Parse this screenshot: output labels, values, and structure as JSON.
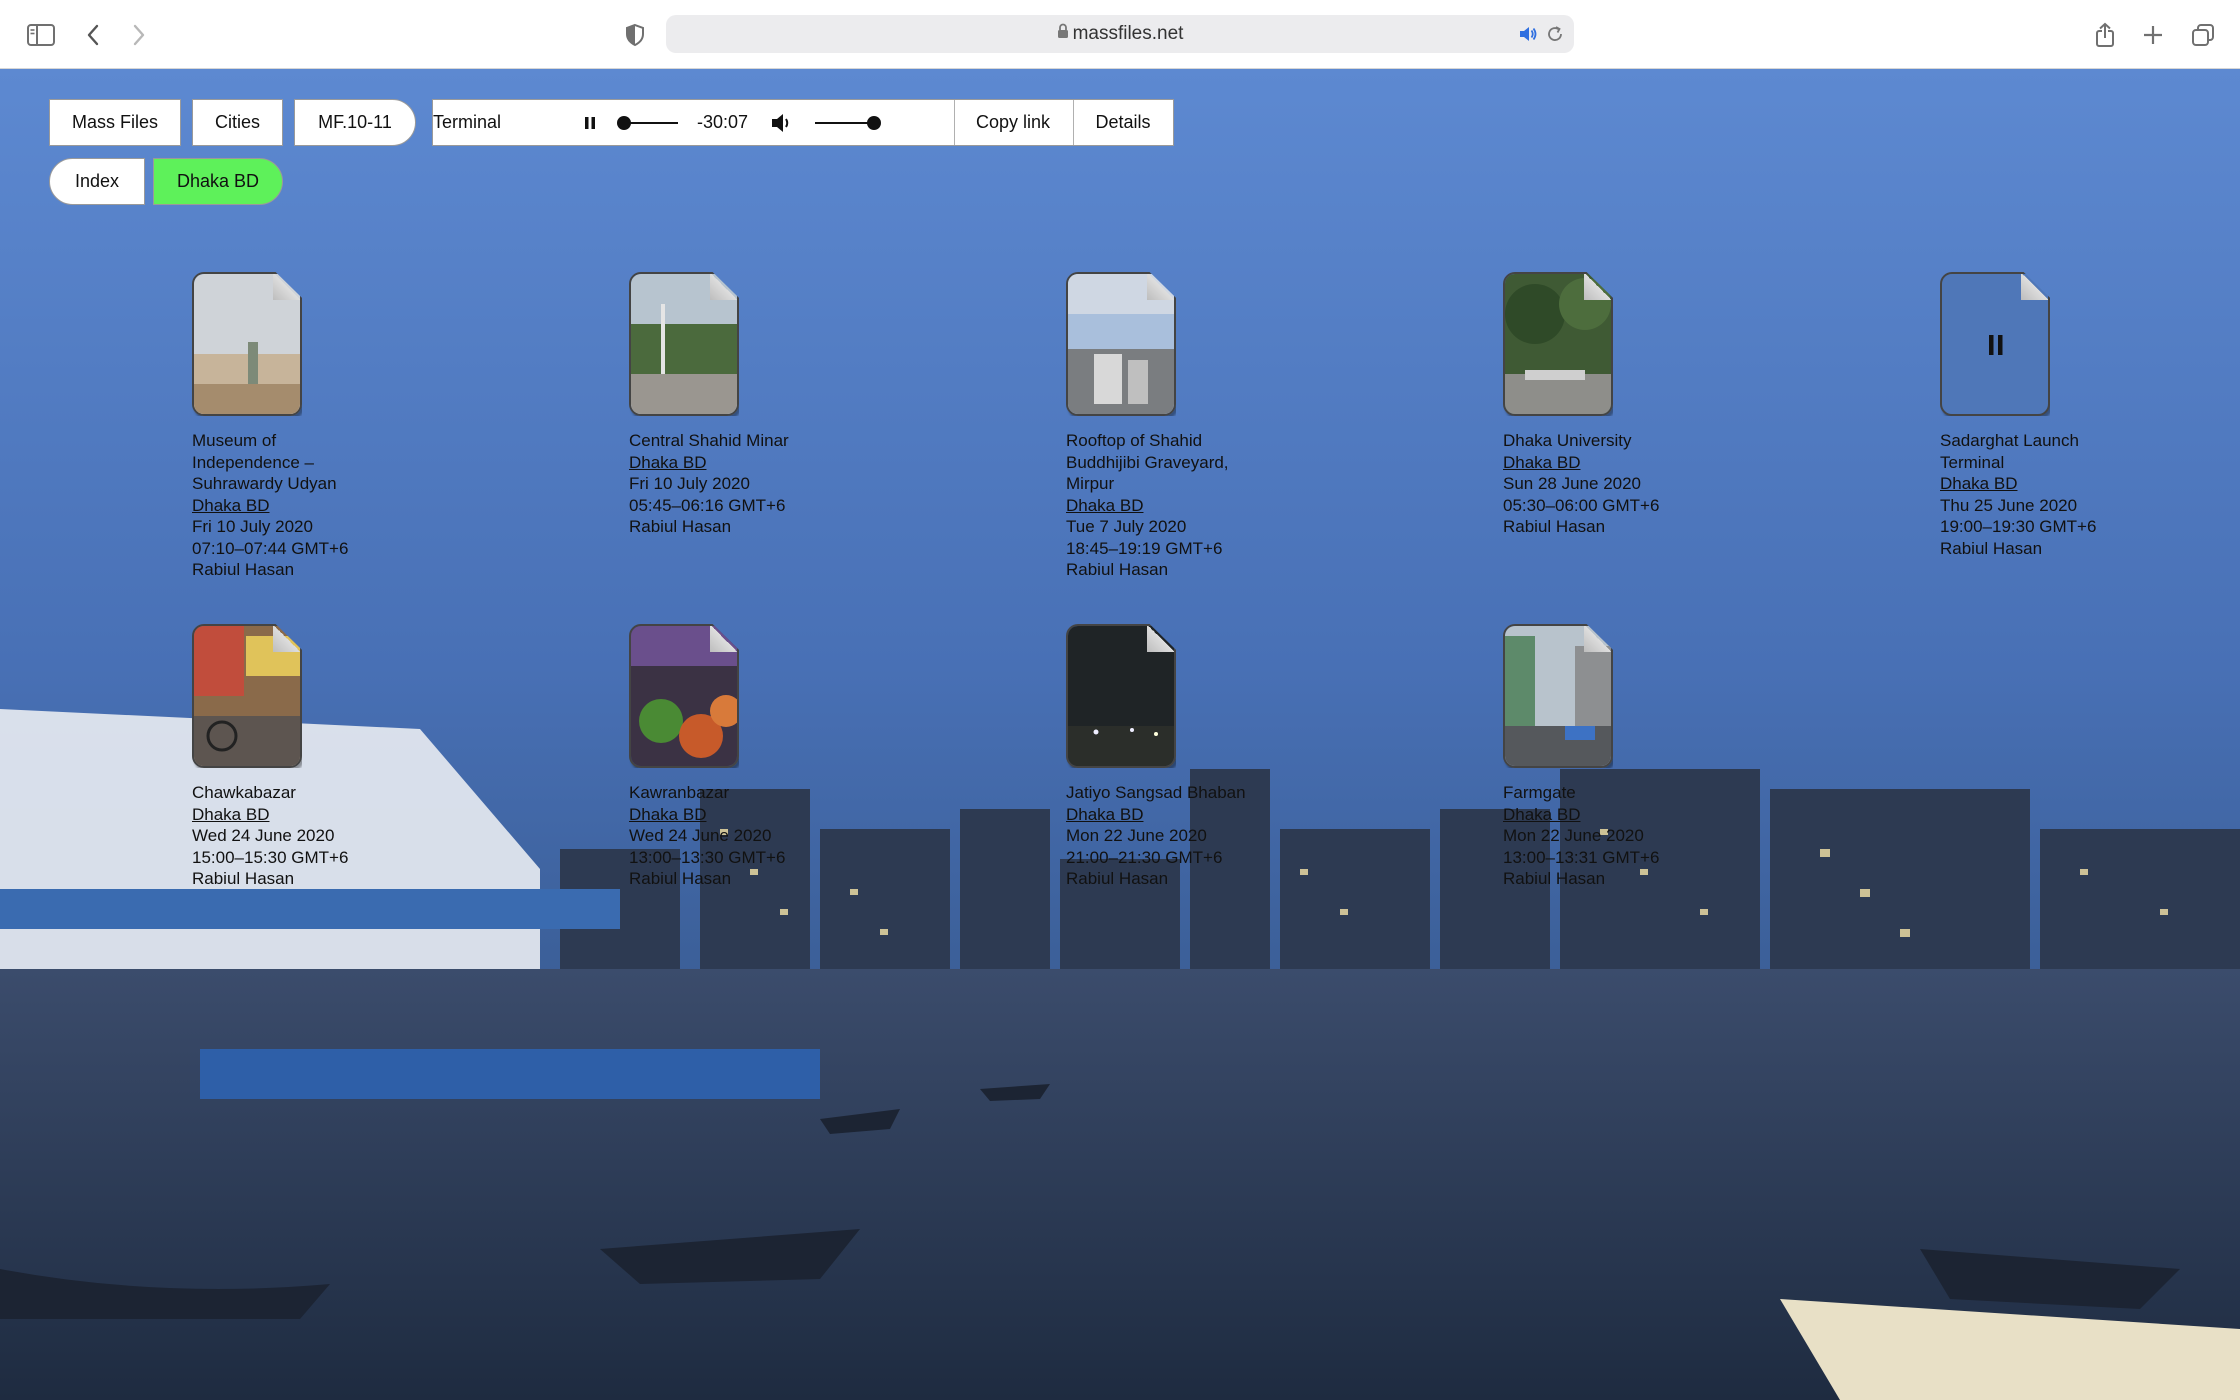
{
  "browser": {
    "url": "massfiles.net"
  },
  "nav": {
    "mass_files": "Mass Files",
    "cities": "Cities",
    "series": "MF.10-11",
    "index": "Index",
    "current_city": "Dhaka BD"
  },
  "player": {
    "track": "Terminal",
    "time": "-30:07",
    "progress_fraction": 0.02,
    "volume_fraction": 0.93,
    "copy_link": "Copy link",
    "details": "Details"
  },
  "files": [
    {
      "title": "Museum of\nIndependence –\nSuhrawardy Udyan",
      "city": "Dhaka BD",
      "date": "Fri 10 July 2020",
      "time": "07:10–07:44 GMT+6",
      "author": "Rabiul Hasan"
    },
    {
      "title": "Central Shahid Minar",
      "city": "Dhaka BD",
      "date": "Fri 10 July 2020",
      "time": "05:45–06:16 GMT+6",
      "author": "Rabiul Hasan"
    },
    {
      "title": "Rooftop of Shahid\nBuddhijibi Graveyard,\nMirpur",
      "city": "Dhaka BD",
      "date": "Tue 7 July 2020",
      "time": "18:45–19:19 GMT+6",
      "author": "Rabiul Hasan"
    },
    {
      "title": "Dhaka University",
      "city": "Dhaka BD",
      "date": "Sun 28 June 2020",
      "time": "05:30–06:00 GMT+6",
      "author": "Rabiul Hasan"
    },
    {
      "title": "Sadarghat Launch\nTerminal",
      "city": "Dhaka BD",
      "date": "Thu 25 June 2020",
      "time": "19:00–19:30 GMT+6",
      "author": "Rabiul Hasan",
      "playing_icon": "pause-icon"
    },
    {
      "title": "Chawkabazar",
      "city": "Dhaka BD",
      "date": "Wed 24 June 2020",
      "time": "15:00–15:30 GMT+6",
      "author": "Rabiul Hasan"
    },
    {
      "title": "Kawranbazar",
      "city": "Dhaka BD",
      "date": "Wed 24 June 2020",
      "time": "13:00–13:30 GMT+6",
      "author": "Rabiul Hasan"
    },
    {
      "title": "Jatiyo Sangsad Bhaban",
      "city": "Dhaka BD",
      "date": "Mon 22 June 2020",
      "time": "21:00–21:30 GMT+6",
      "author": "Rabiul Hasan"
    },
    {
      "title": "Farmgate",
      "city": "Dhaka BD",
      "date": "Mon 22 June 2020",
      "time": "13:00–13:31 GMT+6",
      "author": "Rabiul Hasan"
    }
  ],
  "colors": {
    "active_city": "#5ef15a",
    "sky": "#4a74b8",
    "water": "#2d3f5e"
  }
}
